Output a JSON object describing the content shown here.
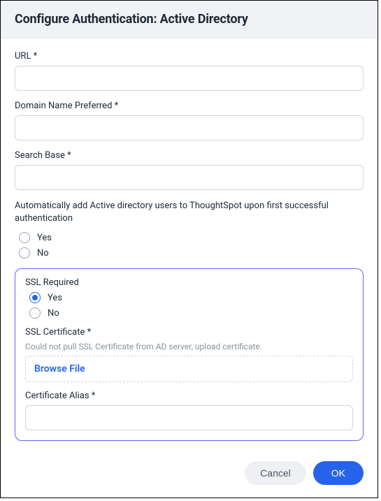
{
  "header": {
    "title": "Configure Authentication: Active Directory"
  },
  "form": {
    "url": {
      "label": "URL *",
      "value": ""
    },
    "domain_name": {
      "label": "Domain Name Preferred *",
      "value": ""
    },
    "search_base": {
      "label": "Search Base *",
      "value": ""
    },
    "auto_add": {
      "label": "Automatically add Active directory users to ThoughtSpot upon first successful authentication",
      "options": {
        "yes": "Yes",
        "no": "No"
      },
      "selected": ""
    },
    "ssl_required": {
      "label": "SSL Required",
      "options": {
        "yes": "Yes",
        "no": "No"
      },
      "selected": "yes"
    },
    "ssl_certificate": {
      "label": "SSL Certificate *",
      "help": "Could not pull SSL Certificate from AD server, upload certificate.",
      "browse_label": "Browse File"
    },
    "cert_alias": {
      "label": "Certificate Alias *",
      "value": ""
    }
  },
  "footer": {
    "cancel": "Cancel",
    "ok": "OK"
  }
}
